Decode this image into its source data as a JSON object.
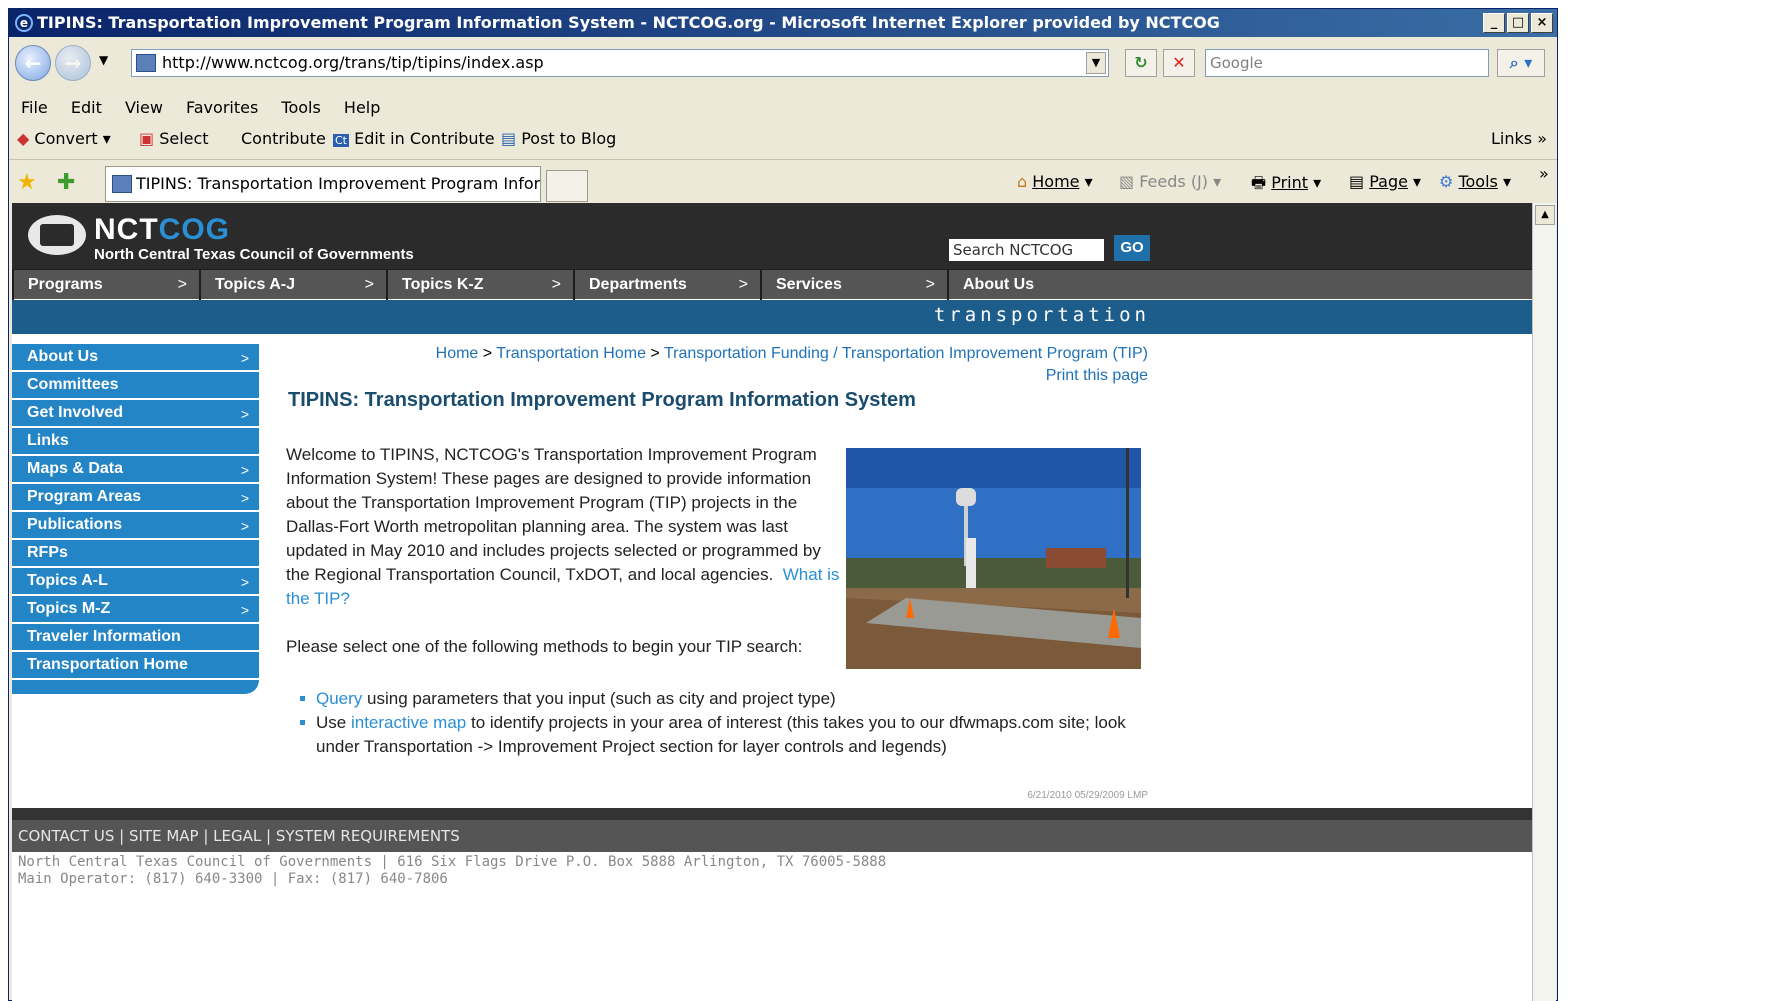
{
  "browser": {
    "title": "TIPINS: Transportation Improvement Program Information System - NCTCOG.org - Microsoft Internet Explorer provided by NCTCOG",
    "url": "http://www.nctcog.org/trans/tip/tipins/index.asp",
    "search_placeholder": "Google",
    "menu": [
      "File",
      "Edit",
      "View",
      "Favorites",
      "Tools",
      "Help"
    ],
    "toolbar": {
      "convert": "Convert",
      "select": "Select",
      "contribute": "Contribute",
      "edit_in_contribute": "Edit in Contribute",
      "post_to_blog": "Post to Blog",
      "links": "Links"
    },
    "tab_label": "TIPINS: Transportation Improvement Program Inform...",
    "commands": {
      "home": "Home",
      "feeds": "Feeds (J)",
      "print": "Print",
      "page": "Page",
      "tools": "Tools"
    }
  },
  "site": {
    "logo_nct": "NCT",
    "logo_cog": "COG",
    "logo_sub": "North Central Texas Council of Governments",
    "search_placeholder": "Search NCTCOG",
    "go_label": "GO",
    "topnav": [
      "Programs",
      "Topics A-J",
      "Topics K-Z",
      "Departments",
      "Services",
      "About Us"
    ],
    "band_label": "transportation",
    "sidebar": [
      {
        "label": "About Us",
        "arrow": ">"
      },
      {
        "label": "Committees",
        "arrow": ""
      },
      {
        "label": "Get Involved",
        "arrow": ">"
      },
      {
        "label": "Links",
        "arrow": ""
      },
      {
        "label": "Maps & Data",
        "arrow": ">"
      },
      {
        "label": "Program Areas",
        "arrow": ">"
      },
      {
        "label": "Publications",
        "arrow": ">"
      },
      {
        "label": "RFPs",
        "arrow": ""
      },
      {
        "label": "Topics A-L",
        "arrow": ">"
      },
      {
        "label": "Topics M-Z",
        "arrow": ">"
      },
      {
        "label": "Traveler Information",
        "arrow": ""
      },
      {
        "label": "Transportation Home",
        "arrow": ""
      }
    ]
  },
  "main": {
    "breadcrumb": {
      "home": "Home",
      "sep": " > ",
      "trans_home": "Transportation Home",
      "current": "Transportation Funding / Transportation Improvement Program (TIP)"
    },
    "print_link": "Print this page",
    "title": "TIPINS:  Transportation Improvement Program Information System",
    "intro": "Welcome to TIPINS, NCTCOG's Transportation Improvement Program Information System!  These pages are designed to provide information about the Transportation Improvement Program (TIP) projects in the Dallas-Fort Worth metropolitan planning area.  The system was last updated in May 2010 and includes projects selected or programmed by the Regional Transportation Council, TxDOT, and local agencies.",
    "what_link": "What is the TIP?",
    "select_prompt": "Please select one of the following methods to begin your TIP search:",
    "bullet1_link": "Query",
    "bullet1_text": " using parameters that you input (such as city and project type)",
    "bullet2_pre": "Use ",
    "bullet2_link": "interactive map",
    "bullet2_text": " to identify projects in your area of interest (this takes you to our dfwmaps.com site; look under Transportation -> Improvement Project section for layer controls and legends)",
    "stamp": "6/21/2010 05/29/2009  LMP"
  },
  "footer": {
    "links": "CONTACT US | SITE MAP | LEGAL | SYSTEM REQUIREMENTS",
    "address": "North Central Texas Council of Governments | 616 Six Flags Drive P.O. Box 5888 Arlington, TX 76005-5888",
    "phones": "Main Operator: (817) 640-3300 | Fax: (817) 640-7806"
  }
}
